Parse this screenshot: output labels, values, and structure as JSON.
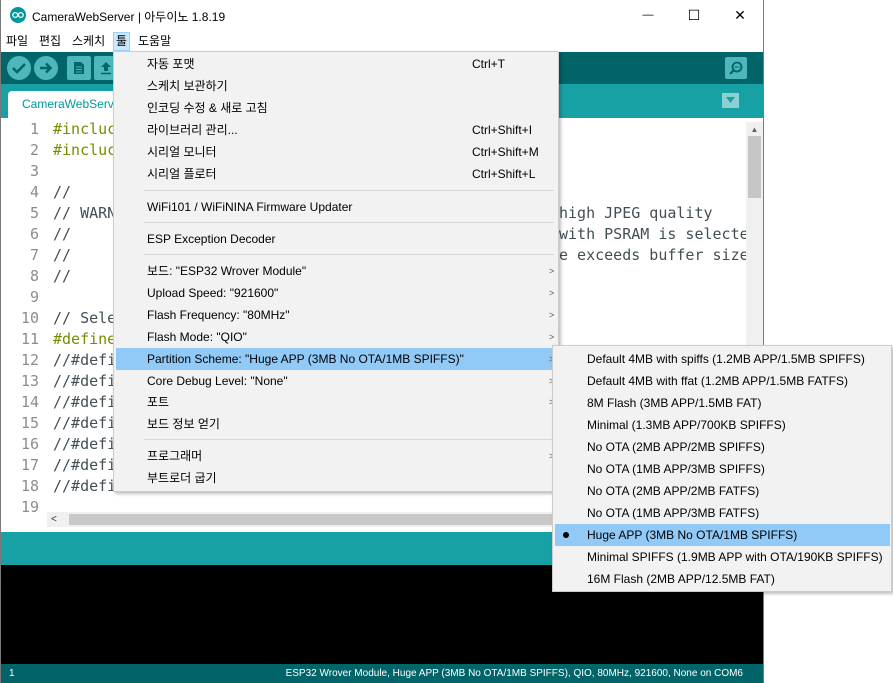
{
  "window": {
    "title": "CameraWebServer | 아두이노 1.8.19",
    "minimize_glyph": "—",
    "maximize_glyph": "☐",
    "close_glyph": "✕"
  },
  "menubar": {
    "items": [
      "파일",
      "편집",
      "스케치",
      "툴",
      "도움말"
    ],
    "active": "툴"
  },
  "toolbar": {
    "buttons": [
      "check-icon",
      "arrow-right-icon",
      "new-file-icon",
      "upload-icon"
    ],
    "serial_icon": "magnifier-icon"
  },
  "tabs": {
    "active_tab": "CameraWebServer"
  },
  "editor": {
    "line_numbers": [
      "1",
      "2",
      "3",
      "4",
      "5",
      "6",
      "7",
      "8",
      "9",
      "10",
      "11",
      "12",
      "13",
      "14",
      "15",
      "16",
      "17",
      "18",
      "19"
    ],
    "lines": [
      "#incluc",
      "#incluc",
      "",
      "//",
      "// WARN",
      "//",
      "//",
      "//",
      "",
      "// Sele",
      "#define",
      "//#defi",
      "//#defi",
      "//#defi",
      "//#defi",
      "//#defi",
      "//#defi",
      "//#defi",
      ""
    ],
    "right_lines": [
      "high JPEG quality",
      "with PSRAM is selecte",
      "e exceeds buffer size"
    ]
  },
  "tools_menu": {
    "items": [
      {
        "label": "자동 포맷",
        "shortcut": "Ctrl+T"
      },
      {
        "label": "스케치 보관하기",
        "shortcut": ""
      },
      {
        "label": "인코딩 수정 & 새로 고침",
        "shortcut": ""
      },
      {
        "label": "라이브러리 관리...",
        "shortcut": "Ctrl+Shift+I"
      },
      {
        "label": "시리얼 모니터",
        "shortcut": "Ctrl+Shift+M"
      },
      {
        "label": "시리얼 플로터",
        "shortcut": "Ctrl+Shift+L"
      },
      {
        "label": "WiFi101 / WiFiNINA Firmware Updater",
        "shortcut": ""
      },
      {
        "label": "ESP Exception Decoder",
        "shortcut": ""
      },
      {
        "label": "보드: \"ESP32 Wrover Module\"",
        "shortcut": ""
      },
      {
        "label": "Upload Speed: \"921600\"",
        "shortcut": ""
      },
      {
        "label": "Flash Frequency: \"80MHz\"",
        "shortcut": ""
      },
      {
        "label": "Flash Mode: \"QIO\"",
        "shortcut": ""
      },
      {
        "label": "Partition Scheme: \"Huge APP (3MB No OTA/1MB SPIFFS)\"",
        "shortcut": ""
      },
      {
        "label": "Core Debug Level: \"None\"",
        "shortcut": ""
      },
      {
        "label": "포트",
        "shortcut": ""
      },
      {
        "label": "보드 정보 얻기",
        "shortcut": ""
      },
      {
        "label": "프로그래머",
        "shortcut": ""
      },
      {
        "label": "부트로더 굽기",
        "shortcut": ""
      }
    ],
    "submenu_arrow": ">"
  },
  "partition_submenu": {
    "items": [
      "Default 4MB with spiffs (1.2MB APP/1.5MB SPIFFS)",
      "Default 4MB with ffat (1.2MB APP/1.5MB FATFS)",
      "8M Flash (3MB APP/1.5MB FAT)",
      "Minimal (1.3MB APP/700KB SPIFFS)",
      "No OTA (2MB APP/2MB SPIFFS)",
      "No OTA (1MB APP/3MB SPIFFS)",
      "No OTA (2MB APP/2MB FATFS)",
      "No OTA (1MB APP/3MB FATFS)",
      "Huge APP (3MB No OTA/1MB SPIFFS)",
      "Minimal SPIFFS (1.9MB APP with OTA/190KB SPIFFS)",
      "16M Flash (2MB APP/12.5MB FAT)"
    ],
    "selected": "Huge APP (3MB No OTA/1MB SPIFFS)"
  },
  "footer": {
    "line_number": "1",
    "board_info": "ESP32 Wrover Module, Huge APP (3MB No OTA/1MB SPIFFS), QIO, 80MHz, 921600, None on COM6"
  },
  "colors": {
    "teal_dark": "#006468",
    "teal": "#17a1a5",
    "menu_highlight": "#91c9f7"
  }
}
